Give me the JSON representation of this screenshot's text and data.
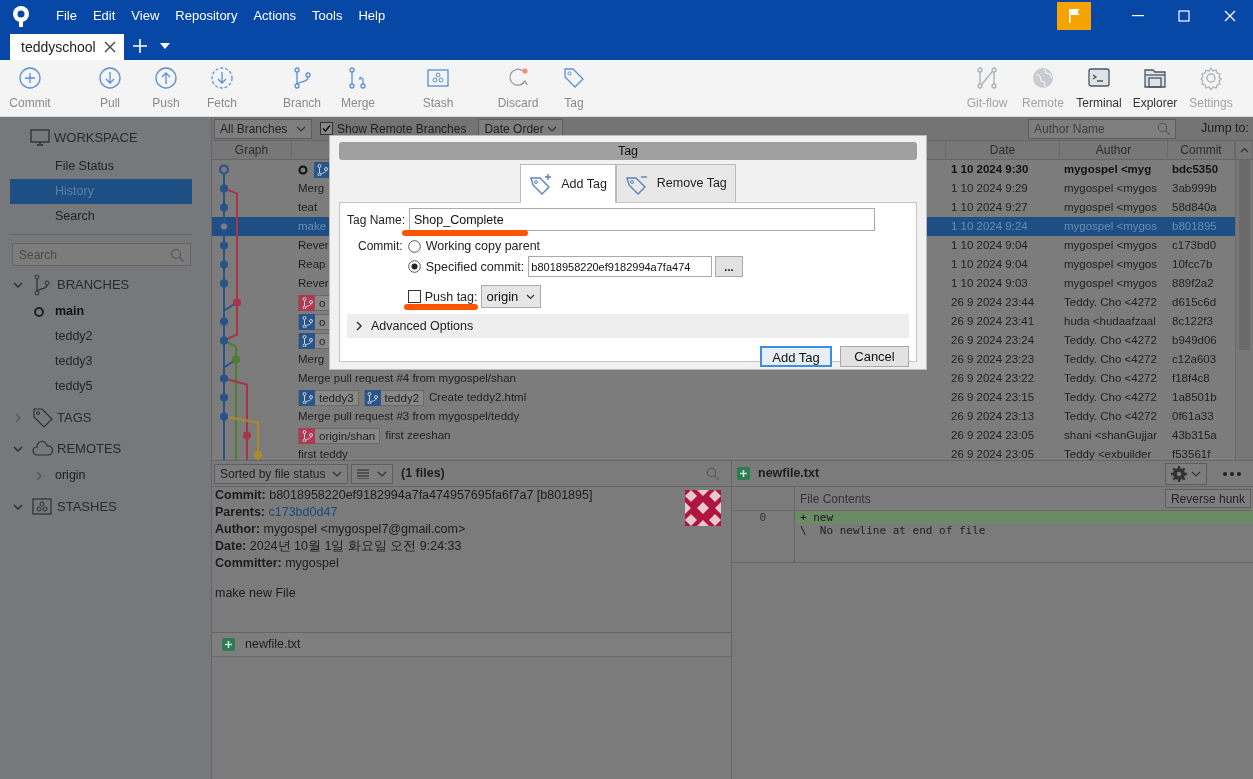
{
  "window": {
    "menus": [
      "File",
      "Edit",
      "View",
      "Repository",
      "Actions",
      "Tools",
      "Help"
    ]
  },
  "repo_tabs": [
    {
      "label": "teddyschool",
      "selected": true
    }
  ],
  "toolbar": {
    "left": [
      {
        "label": "Commit"
      },
      {
        "label": "Pull"
      },
      {
        "label": "Push"
      },
      {
        "label": "Fetch"
      },
      {
        "label": "Branch"
      },
      {
        "label": "Merge"
      },
      {
        "label": "Stash"
      },
      {
        "label": "Discard"
      },
      {
        "label": "Tag"
      }
    ],
    "right": [
      {
        "label": "Git-flow",
        "disabled": true
      },
      {
        "label": "Remote",
        "disabled": true
      },
      {
        "label": "Terminal",
        "disabled": false
      },
      {
        "label": "Explorer",
        "disabled": false
      },
      {
        "label": "Settings",
        "disabled": true
      }
    ]
  },
  "sidebar": {
    "workspace": {
      "title": "WORKSPACE",
      "items": [
        {
          "label": "File Status",
          "selected": false
        },
        {
          "label": "History",
          "selected": true
        },
        {
          "label": "Search",
          "selected": false
        }
      ]
    },
    "search": {
      "placeholder": "Search"
    },
    "groups": [
      {
        "title": "BRANCHES",
        "expanded": true,
        "items": [
          {
            "label": "main",
            "kind": "branch",
            "current": true
          },
          {
            "label": "teddy2",
            "kind": "branch",
            "current": false
          },
          {
            "label": "teddy3",
            "kind": "branch",
            "current": false
          },
          {
            "label": "teddy5",
            "kind": "branch",
            "current": false
          }
        ]
      },
      {
        "title": "TAGS",
        "expanded": false
      },
      {
        "title": "REMOTES",
        "expanded": true,
        "items": [
          {
            "label": "origin",
            "kind": "remote",
            "expanded": false
          }
        ]
      },
      {
        "title": "STASHES",
        "expanded": true
      }
    ]
  },
  "history": {
    "filters": {
      "branches": "All Branches",
      "show_remote": {
        "label": "Show Remote Branches",
        "checked": true
      },
      "order": "Date Order",
      "author_search": {
        "placeholder": "Author Name"
      },
      "jump_label": "Jump to:"
    },
    "columns": [
      "Graph",
      "Date",
      "Author",
      "Commit"
    ],
    "rows": [
      {
        "head": true,
        "selected": false,
        "refs": [
          {
            "color": "#28558a"
          }
        ],
        "date": "1 10 2024 9:30",
        "author": "mygospel <myg",
        "commit": "bdc5350"
      },
      {
        "head": false,
        "selected": false,
        "description": "Merg",
        "date": "1 10 2024 9:29",
        "author": "mygospel <mygos",
        "commit": "3ab999b"
      },
      {
        "head": false,
        "selected": false,
        "description": "teat",
        "date": "1 10 2024 9:27",
        "author": "mygospel <mygos",
        "commit": "58d840a"
      },
      {
        "head": false,
        "selected": true,
        "description": "make",
        "date": "1 10 2024 9:24",
        "author": "mygospel <mygos",
        "commit": "b801895"
      },
      {
        "head": false,
        "selected": false,
        "description": "Rever",
        "date": "1 10 2024 9:04",
        "author": "mygospel <mygos",
        "commit": "c173bd0"
      },
      {
        "head": false,
        "selected": false,
        "description": "Reap",
        "date": "1 10 2024 9:04",
        "author": "mygospel <mygos",
        "commit": "10fcc7b"
      },
      {
        "head": false,
        "selected": false,
        "description": "Rever",
        "date": "1 10 2024 9:03",
        "author": "mygospel <mygos",
        "commit": "889f2a2"
      },
      {
        "head": false,
        "selected": false,
        "refs": [
          {
            "color": "#b03a52",
            "label": "o"
          }
        ],
        "date": "26 9 2024 23:44",
        "author": "Teddy. Cho <4272",
        "commit": "d615c6d"
      },
      {
        "head": false,
        "selected": false,
        "refs": [
          {
            "color": "#28558a",
            "label": "o"
          }
        ],
        "date": "26 9 2024 23:41",
        "author": "huda <hudaafzaal",
        "commit": "8c122f3"
      },
      {
        "head": false,
        "selected": false,
        "refs": [
          {
            "color": "#28558a",
            "label": "o"
          }
        ],
        "date": "26 9 2024 23:24",
        "author": "Teddy. Cho <4272",
        "commit": "b949d06"
      },
      {
        "head": false,
        "selected": false,
        "description": "Merg",
        "date": "26 9 2024 23:23",
        "author": "Teddy. Cho <4272",
        "commit": "c12a603"
      },
      {
        "head": false,
        "selected": false,
        "description": "Merge pull request #4 from mygospel/shan",
        "date": "26 9 2024 23:22",
        "author": "Teddy. Cho <4272",
        "commit": "f18f4c8"
      },
      {
        "head": false,
        "selected": false,
        "refs": [
          {
            "color": "#28558a",
            "label": "teddy3"
          },
          {
            "color": "#28558a",
            "label": "teddy2"
          }
        ],
        "description": "Create teddy2.html",
        "date": "26 9 2024 23:15",
        "author": "Teddy. Cho <4272",
        "commit": "1a8501b"
      },
      {
        "head": false,
        "selected": false,
        "description": "Merge pull request #3 from mygospel/teddy",
        "date": "26 9 2024 23:13",
        "author": "Teddy. Cho <4272",
        "commit": "0f61a33"
      },
      {
        "head": false,
        "selected": false,
        "refs": [
          {
            "color": "#b03a52",
            "label": "origin/shan"
          }
        ],
        "description": "first zeeshan",
        "date": "26 9 2024 23:05",
        "author": "shani <shanGujjar",
        "commit": "43b315a"
      },
      {
        "head": false,
        "selected": false,
        "description": "first teddy",
        "date": "26 9 2024 23:05",
        "author": "Teddy <exbuilder",
        "commit": "f53561f"
      }
    ]
  },
  "details": {
    "sort": "Sorted by file status",
    "count": "(1 files)",
    "fields": [
      {
        "label": "Commit:",
        "value": "b8018958220ef9182994a7fa474957695fa6f7a7 [b801895]",
        "kind": "text"
      },
      {
        "label": "Parents:",
        "value": "c173bd0d47",
        "kind": "link"
      },
      {
        "label": "Author:",
        "value": "mygospel <mygospel7@gmail.com>",
        "kind": "text"
      },
      {
        "label": "Date:",
        "value": "2024년 10월 1일 화요일 오전 9:24:33",
        "kind": "text"
      },
      {
        "label": "Committer:",
        "value": "mygospel",
        "kind": "text"
      }
    ],
    "message": "make new File",
    "files": [
      {
        "name": "newfile.txt"
      }
    ]
  },
  "diff": {
    "file": "newfile.txt",
    "header": "File Contents",
    "reverse_button": "Reverse hunk",
    "lines": [
      {
        "number": "0",
        "text": "+ new",
        "kind": "added"
      },
      {
        "text": "\\  No newline at end of file",
        "kind": "note"
      }
    ]
  },
  "dialog": {
    "title": "Tag",
    "tabs": [
      {
        "label": "Add Tag",
        "selected": true
      },
      {
        "label": "Remove Tag",
        "selected": false
      }
    ],
    "tag_name": {
      "label": "Tag Name:",
      "value": "Shop_Complete"
    },
    "commit": {
      "label": "Commit:",
      "options": [
        {
          "label": "Working copy parent",
          "selected": false
        },
        {
          "label": "Specified commit:",
          "selected": true
        }
      ],
      "value": "b8018958220ef9182994a7fa474",
      "browse": "..."
    },
    "push_tag": {
      "label": "Push tag:",
      "checked": false,
      "remote": "origin"
    },
    "advanced": {
      "label": "Advanced Options",
      "expanded": false
    },
    "buttons": [
      {
        "label": "Add Tag",
        "kind": "primary"
      },
      {
        "label": "Cancel",
        "kind": "secondary"
      }
    ]
  }
}
